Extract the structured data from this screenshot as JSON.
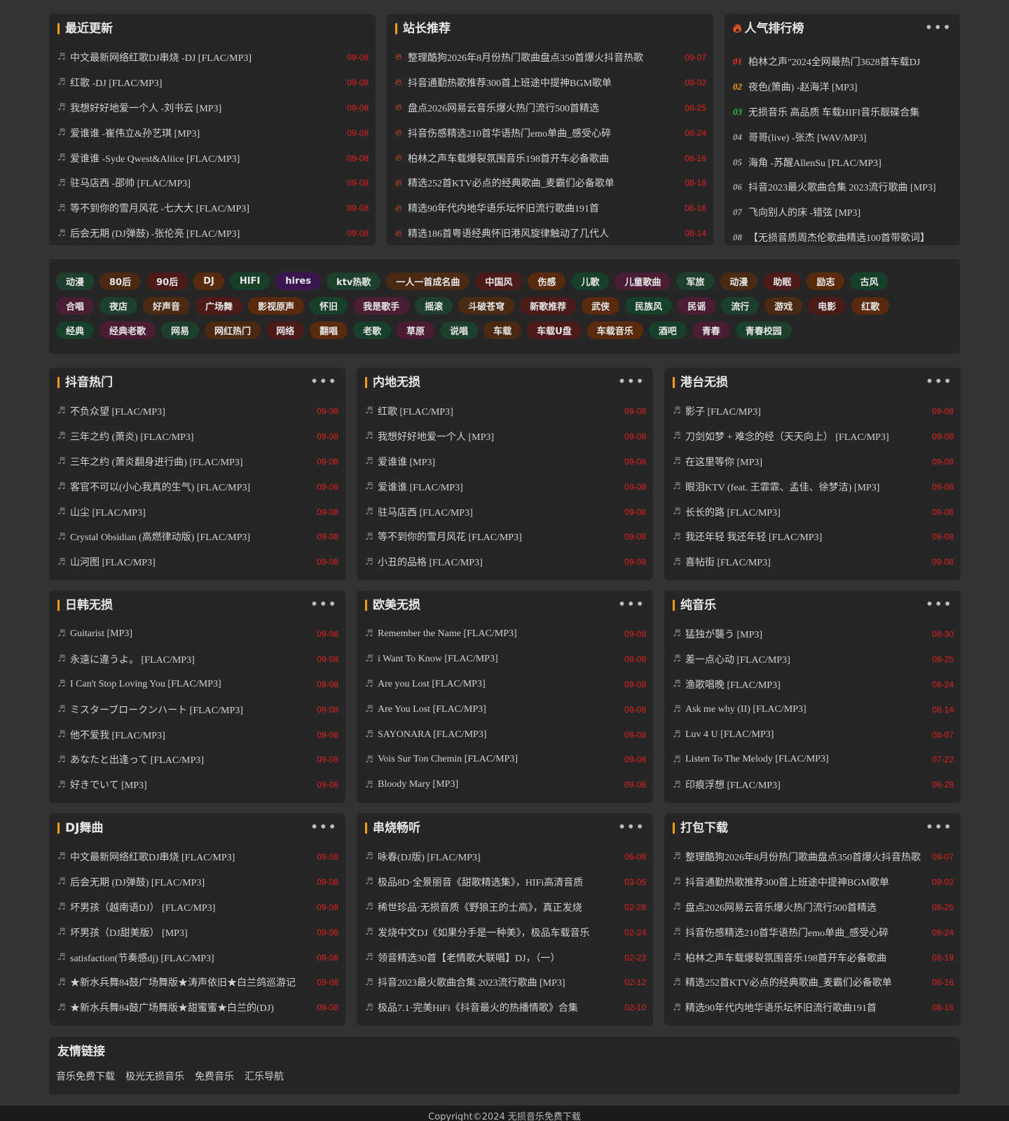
{
  "top_panels": [
    {
      "title": "最近更新",
      "rows": [
        {
          "text": "中文最新网络红歌DJ串烧 -DJ [FLAC/MP3]",
          "date": "09-08"
        },
        {
          "text": "红歌 -DJ [FLAC/MP3]",
          "date": "09-08"
        },
        {
          "text": "我想好好地爱一个人 -刘书云 [MP3]",
          "date": "09-08"
        },
        {
          "text": "爱谁谁 -崔伟立&孙艺琪 [MP3]",
          "date": "09-08"
        },
        {
          "text": "爱谁谁 -Syde Qwest&Aliice [FLAC/MP3]",
          "date": "09-08"
        },
        {
          "text": "驻马店西 -邵帅 [FLAC/MP3]",
          "date": "09-08"
        },
        {
          "text": "等不到你的雪月风花 -七大大 [FLAC/MP3]",
          "date": "09-08"
        },
        {
          "text": "后会无期 (DJ弹鼓) -张伦亮 [FLAC/MP3]",
          "date": "09-08"
        }
      ]
    },
    {
      "title": "站长推荐",
      "rows": [
        {
          "text": "整理酷狗2026年8月份热门歌曲盘点350首爆火抖音热歌",
          "date": "09-07"
        },
        {
          "text": "抖音通勤热歌推荐300首上班途中提神BGM歌单",
          "date": "09-02"
        },
        {
          "text": "盘点2026网易云音乐爆火热门流行500首精选",
          "date": "08-25"
        },
        {
          "text": "抖音伤感精选210首华语热门emo单曲_感受心碎",
          "date": "08-24"
        },
        {
          "text": "柏林之声车载爆裂氛围音乐198首开车必备歌曲",
          "date": "08-19"
        },
        {
          "text": "精选252首KTV必点的经典歌曲_麦霸们必备歌单",
          "date": "08-18"
        },
        {
          "text": "精选90年代内地华语乐坛怀旧流行歌曲191首",
          "date": "08-16"
        },
        {
          "text": "精选186首粤语经典怀旧港风旋律触动了几代人",
          "date": "08-14"
        }
      ]
    },
    {
      "title": "人气排行榜",
      "more": "•••",
      "rows": [
        {
          "rank": "01",
          "text": "柏林之声\"2024全网最热门3628首车载DJ"
        },
        {
          "rank": "02",
          "text": "夜色(箫曲) -赵海洋 [MP3]"
        },
        {
          "rank": "03",
          "text": "无损音乐 高品质 车载HIFI音乐靓碟合集"
        },
        {
          "rank": "04",
          "text": "哥哥(live) -张杰 [WAV/MP3]"
        },
        {
          "rank": "05",
          "text": "海角 -苏醒AllenSu [FLAC/MP3]"
        },
        {
          "rank": "06",
          "text": "抖音2023最火歌曲合集 2023流行歌曲 [MP3]"
        },
        {
          "rank": "07",
          "text": "飞向别人的床 -错弦 [MP3]"
        },
        {
          "rank": "08",
          "text": "【无损音质周杰伦歌曲精选100首带歌词】"
        }
      ]
    }
  ],
  "tags": [
    {
      "label": "动漫",
      "color": "#1d3f2e"
    },
    {
      "label": "80后",
      "color": "#4a2a12"
    },
    {
      "label": "90后",
      "color": "#4d1a1a"
    },
    {
      "label": "DJ",
      "color": "#5a2a0e"
    },
    {
      "label": "HIFI",
      "color": "#16402a"
    },
    {
      "label": "hires",
      "color": "#3a1550"
    },
    {
      "label": "ktv热歌",
      "color": "#1d3f2e"
    },
    {
      "label": "一人一首成名曲",
      "color": "#4a2a12"
    },
    {
      "label": "中国风",
      "color": "#4d1a1a"
    },
    {
      "label": "伤感",
      "color": "#5a2a0e"
    },
    {
      "label": "儿歌",
      "color": "#16402a"
    },
    {
      "label": "儿童歌曲",
      "color": "#4a1d35"
    },
    {
      "label": "军旅",
      "color": "#1d3f2e"
    },
    {
      "label": "动漫",
      "color": "#4a2a12"
    },
    {
      "label": "助眠",
      "color": "#4d1a1a"
    },
    {
      "label": "励志",
      "color": "#5a2a0e"
    },
    {
      "label": "古风",
      "color": "#16402a"
    },
    {
      "label": "合唱",
      "color": "#4a1d35"
    },
    {
      "label": "夜店",
      "color": "#1d3f2e"
    },
    {
      "label": "好声音",
      "color": "#4a2a12"
    },
    {
      "label": "广场舞",
      "color": "#4d1a1a"
    },
    {
      "label": "影视原声",
      "color": "#5a2a0e"
    },
    {
      "label": "怀旧",
      "color": "#16402a"
    },
    {
      "label": "我是歌手",
      "color": "#4a1d35"
    },
    {
      "label": "摇滚",
      "color": "#1d3f2e"
    },
    {
      "label": "斗破苍穹",
      "color": "#4a2a12"
    },
    {
      "label": "新歌推荐",
      "color": "#4d1a1a"
    },
    {
      "label": "武侠",
      "color": "#5a2a0e"
    },
    {
      "label": "民族风",
      "color": "#16402a"
    },
    {
      "label": "民谣",
      "color": "#4a1d35"
    },
    {
      "label": "流行",
      "color": "#1d3f2e"
    },
    {
      "label": "游戏",
      "color": "#4a2a12"
    },
    {
      "label": "电影",
      "color": "#4d1a1a"
    },
    {
      "label": "红歌",
      "color": "#5a2a0e"
    },
    {
      "label": "经典",
      "color": "#16402a"
    },
    {
      "label": "经典老歌",
      "color": "#4a1d35"
    },
    {
      "label": "网易",
      "color": "#1d3f2e"
    },
    {
      "label": "网红热门",
      "color": "#4a2a12"
    },
    {
      "label": "网络",
      "color": "#4d1a1a"
    },
    {
      "label": "翻唱",
      "color": "#5a2a0e"
    },
    {
      "label": "老歌",
      "color": "#16402a"
    },
    {
      "label": "草原",
      "color": "#4a1d35"
    },
    {
      "label": "说唱",
      "color": "#1d3f2e"
    },
    {
      "label": "车载",
      "color": "#4a2a12"
    },
    {
      "label": "车载U盘",
      "color": "#4d1a1a"
    },
    {
      "label": "车载音乐",
      "color": "#5a2a0e"
    },
    {
      "label": "酒吧",
      "color": "#16402a"
    },
    {
      "label": "青春",
      "color": "#4a1d35"
    },
    {
      "label": "青春校园",
      "color": "#1d3f2e"
    }
  ],
  "panels": [
    {
      "title": "抖音热门",
      "more": "•••",
      "rows": [
        {
          "text": "不负众望 [FLAC/MP3]",
          "date": "09-08"
        },
        {
          "text": "三年之约 (萧炎) [FLAC/MP3]",
          "date": "09-08"
        },
        {
          "text": "三年之约 (萧炎翻身进行曲) [FLAC/MP3]",
          "date": "09-08"
        },
        {
          "text": "客官不可以(小心我真的生气) [FLAC/MP3]",
          "date": "09-08"
        },
        {
          "text": "山尘 [FLAC/MP3]",
          "date": "09-08"
        },
        {
          "text": "Crystal Obsidian (高燃律动版) [FLAC/MP3]",
          "date": "09-08"
        },
        {
          "text": "山河图 [FLAC/MP3]",
          "date": "09-08"
        }
      ]
    },
    {
      "title": "内地无损",
      "more": "•••",
      "rows": [
        {
          "text": "红歌 [FLAC/MP3]",
          "date": "09-08"
        },
        {
          "text": "我想好好地爱一个人 [MP3]",
          "date": "09-08"
        },
        {
          "text": "爱谁谁 [MP3]",
          "date": "09-08"
        },
        {
          "text": "爱谁谁 [FLAC/MP3]",
          "date": "09-08"
        },
        {
          "text": "驻马店西 [FLAC/MP3]",
          "date": "09-08"
        },
        {
          "text": "等不到你的雪月风花 [FLAC/MP3]",
          "date": "09-08"
        },
        {
          "text": "小丑的品格 [FLAC/MP3]",
          "date": "09-08"
        }
      ]
    },
    {
      "title": "港台无损",
      "more": "•••",
      "rows": [
        {
          "text": "影子 [FLAC/MP3]",
          "date": "09-08"
        },
        {
          "text": "刀剑如梦 + 难念的经（天天向上） [FLAC/MP3]",
          "date": "09-08"
        },
        {
          "text": "在这里等你 [MP3]",
          "date": "09-08"
        },
        {
          "text": "眼泪KTV (feat. 王霏霏、孟佳、徐梦洁) [MP3]",
          "date": "09-08"
        },
        {
          "text": "长长的路 [FLAC/MP3]",
          "date": "09-08"
        },
        {
          "text": "我还年轻 我还年轻 [FLAC/MP3]",
          "date": "09-08"
        },
        {
          "text": "喜帖街 [FLAC/MP3]",
          "date": "09-08"
        }
      ]
    },
    {
      "title": "日韩无损",
      "more": "•••",
      "rows": [
        {
          "text": "Guitarist [MP3]",
          "date": "09-08"
        },
        {
          "text": "永遠に違うよ。 [FLAC/MP3]",
          "date": "09-08"
        },
        {
          "text": "I Can't Stop Loving You [FLAC/MP3]",
          "date": "09-08"
        },
        {
          "text": "ミスターブロークンハート [FLAC/MP3]",
          "date": "09-08"
        },
        {
          "text": "他不爱我 [FLAC/MP3]",
          "date": "09-08"
        },
        {
          "text": "あなたと出逢って [FLAC/MP3]",
          "date": "09-08"
        },
        {
          "text": "好きでいて [MP3]",
          "date": "09-08"
        }
      ]
    },
    {
      "title": "欧美无损",
      "more": "•••",
      "rows": [
        {
          "text": "Remember the Name [FLAC/MP3]",
          "date": "09-08"
        },
        {
          "text": "i Want To Know [FLAC/MP3]",
          "date": "09-08"
        },
        {
          "text": "Are you Lost [FLAC/MP3]",
          "date": "09-08"
        },
        {
          "text": "Are You Lost [FLAC/MP3]",
          "date": "09-08"
        },
        {
          "text": "SAYONARA [FLAC/MP3]",
          "date": "09-08"
        },
        {
          "text": "Vois Sur Ton Chemin [FLAC/MP3]",
          "date": "09-08"
        },
        {
          "text": "Bloody Mary [MP3]",
          "date": "09-08"
        }
      ]
    },
    {
      "title": "纯音乐",
      "more": "•••",
      "rows": [
        {
          "text": "猛独が襲う [MP3]",
          "date": "08-30"
        },
        {
          "text": "差一点心动 [FLAC/MP3]",
          "date": "08-25"
        },
        {
          "text": "渔歌唱晚 [FLAC/MP3]",
          "date": "08-24"
        },
        {
          "text": "Ask me why (II) [FLAC/MP3]",
          "date": "08-14"
        },
        {
          "text": "Luv 4 U [FLAC/MP3]",
          "date": "08-07"
        },
        {
          "text": "Listen To The Melody [FLAC/MP3]",
          "date": "07-22"
        },
        {
          "text": "印痕浮想 [FLAC/MP3]",
          "date": "06-28"
        }
      ]
    },
    {
      "title": "DJ舞曲",
      "more": "•••",
      "rows": [
        {
          "text": "中文最新网络红歌DJ串烧 [FLAC/MP3]",
          "date": "09-08"
        },
        {
          "text": "后会无期 (DJ弹鼓) [FLAC/MP3]",
          "date": "09-08"
        },
        {
          "text": "坏男孩（越南语DJ） [FLAC/MP3]",
          "date": "09-08"
        },
        {
          "text": "坏男孩（DJ甜美版） [MP3]",
          "date": "09-08"
        },
        {
          "text": "satisfaction(节奏感dj) [FLAC/MP3]",
          "date": "09-08"
        },
        {
          "text": "★新水兵舞84鼓广场舞版★涛声依旧★白兰鸽巡游记",
          "date": "09-08"
        },
        {
          "text": "★新水兵舞84鼓广场舞版★甜蜜蜜★白兰的(DJ)",
          "date": "09-08"
        }
      ]
    },
    {
      "title": "串烧畅听",
      "more": "•••",
      "rows": [
        {
          "text": "咏春(DJ版) [FLAC/MP3]",
          "date": "06-08"
        },
        {
          "text": "极品8D·全景丽音《甜歌精选集》，HIFi高清音质",
          "date": "03-05"
        },
        {
          "text": "稀世珍品·无损音质《野狼王的士高》，真正发烧",
          "date": "02-28"
        },
        {
          "text": "发烧中文DJ《如果分手是一种美》，极品车载音乐",
          "date": "02-24"
        },
        {
          "text": "领音精选30首【老情歌大联唱】DJ，（一）",
          "date": "02-23"
        },
        {
          "text": "抖音2023最火歌曲合集 2023流行歌曲 [MP3]",
          "date": "02-12"
        },
        {
          "text": "极品7.1·完美HiFi《抖音最火的热播情歌》合集",
          "date": "02-10"
        }
      ]
    },
    {
      "title": "打包下载",
      "more": "•••",
      "rows": [
        {
          "text": "整理酷狗2026年8月份热门歌曲盘点350首爆火抖音热歌",
          "date": "09-07"
        },
        {
          "text": "抖音通勤热歌推荐300首上班途中提神BGM歌单",
          "date": "09-02"
        },
        {
          "text": "盘点2026网易云音乐爆火热门流行500首精选",
          "date": "08-25"
        },
        {
          "text": "抖音伤感精选210首华语热门emo单曲_感受心碎",
          "date": "08-24"
        },
        {
          "text": "柏林之声车载爆裂氛围音乐198首开车必备歌曲",
          "date": "08-19"
        },
        {
          "text": "精选252首KTV必点的经典歌曲_麦霸们必备歌单",
          "date": "08-18"
        },
        {
          "text": "精选90年代内地华语乐坛怀旧流行歌曲191首",
          "date": "08-16"
        }
      ]
    }
  ],
  "friend_links": {
    "title": "友情链接",
    "items": [
      "音乐免费下载",
      "极光无损音乐",
      "免费音乐",
      "汇乐导航"
    ]
  },
  "footer": {
    "text": "Copyright©2024 无损音乐免费下载"
  },
  "colors": {
    "accent": "#ff9a1a",
    "date": "#e0201f",
    "card": "#262626",
    "page": "#333333"
  },
  "icons": {
    "row": "music-note-icon",
    "recommend_row": "fire-icon",
    "more": "more-dots-icon"
  }
}
